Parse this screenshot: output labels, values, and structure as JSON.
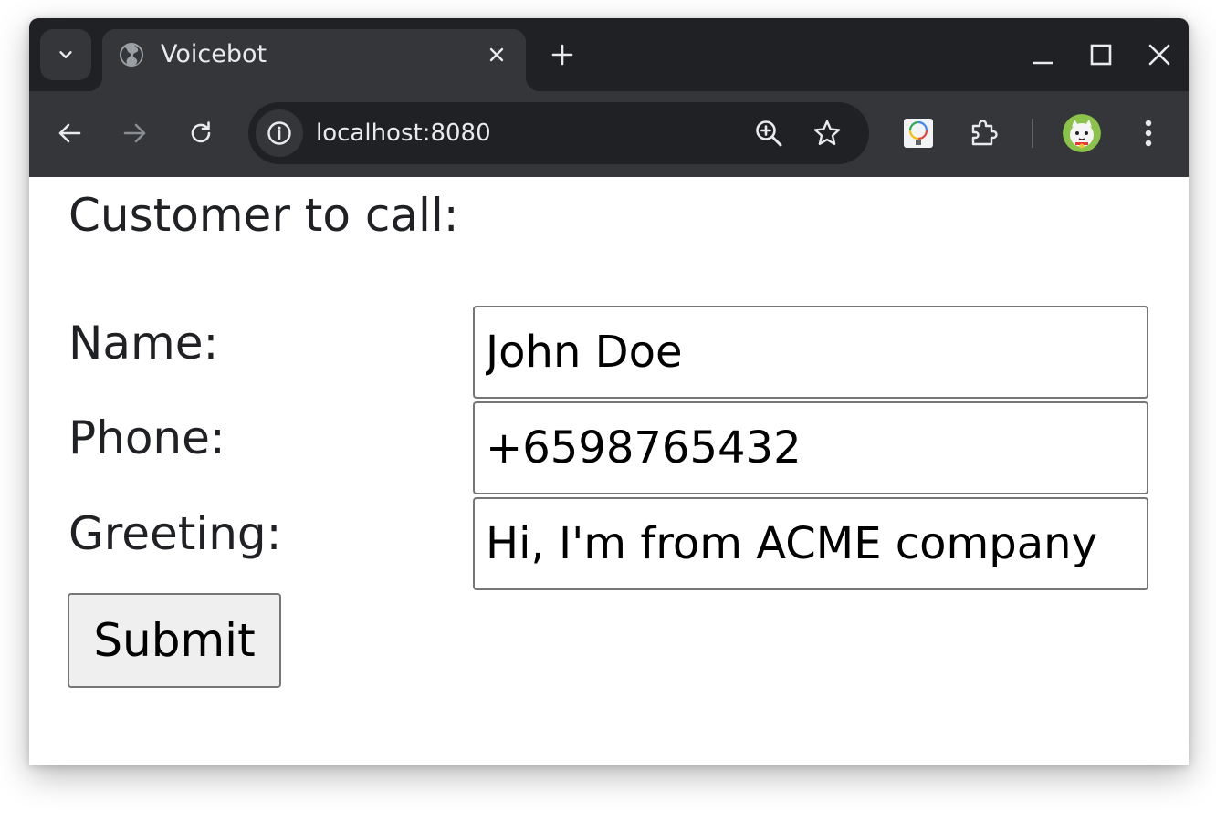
{
  "browser": {
    "tab_title": "Voicebot",
    "url": "localhost:8080",
    "theme": {
      "tabstrip_bg": "#202124",
      "toolbar_bg": "#35363a",
      "text": "#e8eaed"
    }
  },
  "form": {
    "heading": "Customer to call:",
    "name_label": "Name:",
    "name_value": "John Doe",
    "phone_label": "Phone:",
    "phone_value": "+6598765432",
    "greeting_label": "Greeting:",
    "greeting_value": "Hi, I'm from ACME company",
    "submit_label": "Submit"
  },
  "icons": {
    "tab_search": "chevron-down-icon",
    "favicon": "globe-icon",
    "tab_close": "close-icon",
    "new_tab": "plus-icon",
    "minimize": "minimize-icon",
    "maximize": "maximize-icon",
    "close_window": "close-icon",
    "back": "arrow-left-icon",
    "forward": "arrow-right-icon",
    "reload": "reload-icon",
    "site_info": "info-icon",
    "zoom": "zoom-in-icon",
    "bookmark": "star-icon",
    "extension_color": "color-picker-extension-icon",
    "extensions": "puzzle-icon",
    "profile": "avatar",
    "menu": "kebab-menu-icon"
  }
}
